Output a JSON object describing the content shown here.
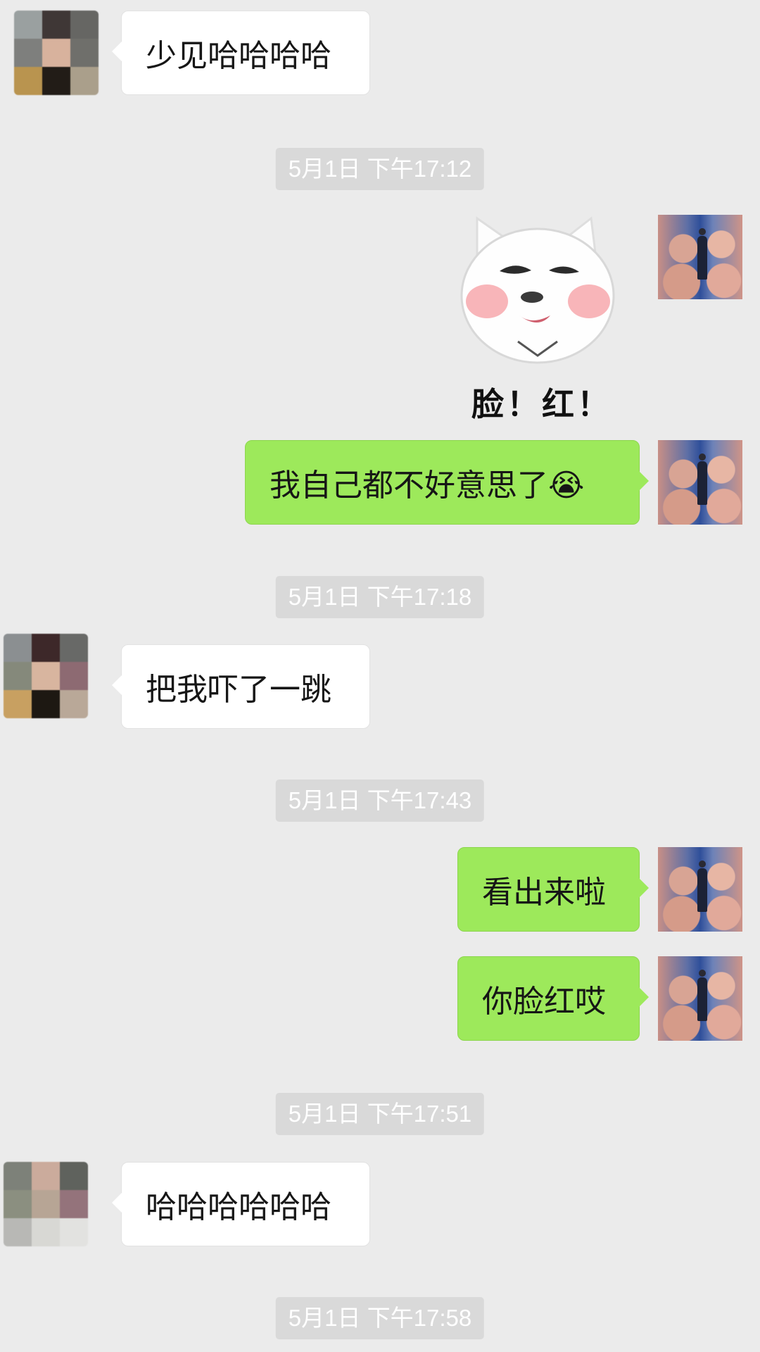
{
  "messages": {
    "m1": "少见哈哈哈哈",
    "m2_caption": "脸！红！",
    "m3": "我自己都不好意思了😭",
    "m4": "把我吓了一跳",
    "m5": "看出来啦",
    "m6": "你脸红哎",
    "m7": "哈哈哈哈哈哈"
  },
  "timestamps": {
    "t1": "5月1日 下午17:12",
    "t2": "5月1日 下午17:18",
    "t3": "5月1日 下午17:43",
    "t4": "5月1日 下午17:51",
    "t5": "5月1日 下午17:58"
  },
  "icons": {
    "contact_avatar": "blurred-contact-avatar",
    "self_avatar": "self-avatar-illustration",
    "sticker": "blushing-cat-sticker-icon"
  },
  "colors": {
    "background": "#ebebeb",
    "incoming_bubble": "#ffffff",
    "outgoing_bubble": "#9de95b",
    "time_pill": "#d9d9d9"
  }
}
